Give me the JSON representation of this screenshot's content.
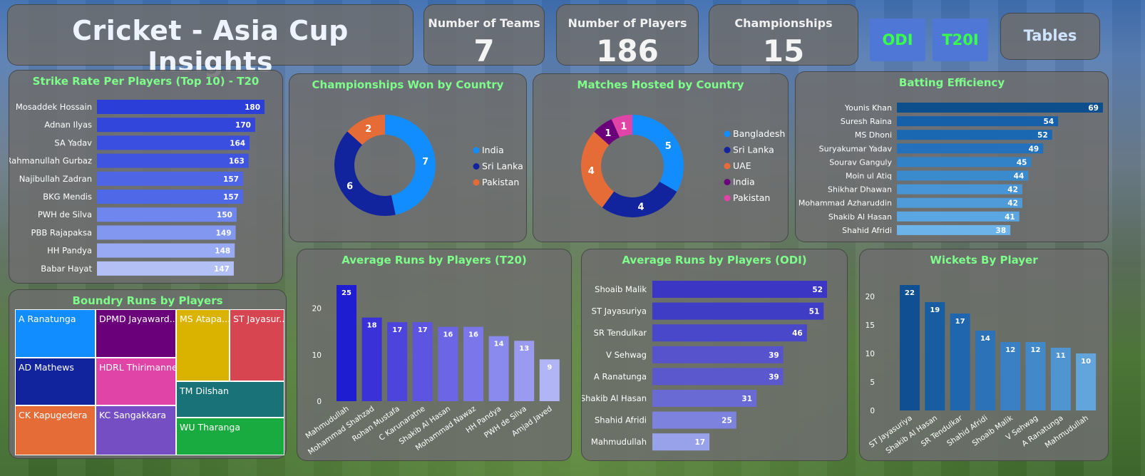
{
  "header": {
    "title": "Cricket - Asia Cup Insights"
  },
  "kpis": [
    {
      "label": "Number of Teams",
      "value": "7"
    },
    {
      "label": "Number of Players",
      "value": "186"
    },
    {
      "label": "Championships",
      "value": "15"
    }
  ],
  "buttons": {
    "odi": "ODI",
    "t20i": "T20I",
    "tables": "Tables"
  },
  "chart_data": [
    {
      "id": "strike_rate",
      "type": "bar",
      "orientation": "horizontal",
      "title": "Strike Rate Per Players (Top 10) - T20",
      "categories": [
        "Mosaddek Hossain",
        "Adnan Ilyas",
        "SA Yadav",
        "Rahmanullah Gurbaz",
        "Najibullah Zadran",
        "BKG Mendis",
        "PWH de Silva",
        "PBB Rajapaksa",
        "HH Pandya",
        "Babar Hayat"
      ],
      "values": [
        180,
        170,
        164,
        163,
        157,
        157,
        150,
        149,
        148,
        147
      ],
      "colors": [
        "#2b3fd8",
        "#3246dc",
        "#3a4ee0",
        "#3f55e2",
        "#4e65e6",
        "#4f68e8",
        "#6f86ee",
        "#8197f0",
        "#98aaf3",
        "#b3c0f6"
      ]
    },
    {
      "id": "championships_won",
      "type": "pie",
      "title": "Championships Won by Country",
      "categories": [
        "India",
        "Sri Lanka",
        "Pakistan"
      ],
      "values": [
        7,
        6,
        2
      ],
      "colors": [
        "#118dff",
        "#12239e",
        "#e66c37"
      ],
      "legend": "right"
    },
    {
      "id": "matches_hosted",
      "type": "pie",
      "title": "Matches Hosted by Country",
      "categories": [
        "Bangladesh",
        "Sri Lanka",
        "UAE",
        "India",
        "Pakistan"
      ],
      "values": [
        5,
        4,
        4,
        1,
        1
      ],
      "colors": [
        "#118dff",
        "#12239e",
        "#e66c37",
        "#6b007b",
        "#e044a7"
      ],
      "legend": "right"
    },
    {
      "id": "batting_efficiency",
      "type": "bar",
      "orientation": "horizontal",
      "title": "Batting Efficiency",
      "categories": [
        "Younis Khan",
        "Suresh Raina",
        "MS Dhoni",
        "Suryakumar Yadav",
        "Sourav Ganguly",
        "Moin ul Atiq",
        "Shikhar Dhawan",
        "Mohammad Azharuddin",
        "Shakib Al Hasan",
        "Shahid Afridi"
      ],
      "values": [
        69,
        54,
        52,
        49,
        45,
        44,
        42,
        42,
        41,
        38
      ],
      "colors": [
        "#0d4e8c",
        "#1560a8",
        "#1b68b2",
        "#2370bc",
        "#3282c8",
        "#3a8ace",
        "#4795d6",
        "#4f9bda",
        "#5aa6e2",
        "#6cb3ea"
      ]
    },
    {
      "id": "boundary_runs",
      "type": "heatmap",
      "title": "Boundry Runs by Players",
      "categories": [
        "A Ranatunga",
        "DPMD Jayawardena",
        "MS Atapattu",
        "ST Jayasuriya",
        "AD Mathews",
        "HDRL Thirimanne",
        "TM Dilshan",
        "CK Kapugedera",
        "KC Sangakkara",
        "WU Tharanga"
      ],
      "labels_shown": [
        "A Ranatunga",
        "DPMD Jayaward...",
        "MS Atapa...",
        "ST Jayasur...",
        "AD Mathews",
        "HDRL Thirimanne",
        "TM Dilshan",
        "CK Kapugedera",
        "KC Sangakkara",
        "WU Tharanga"
      ],
      "colors": [
        "#118dff",
        "#6b007b",
        "#d9b300",
        "#d64550",
        "#12239e",
        "#e044a7",
        "#197278",
        "#e66c37",
        "#744ec2",
        "#1aab40"
      ]
    },
    {
      "id": "avg_runs_t20",
      "type": "bar",
      "orientation": "vertical",
      "title": "Average Runs by Players (T20)",
      "categories": [
        "Mahmudullah",
        "Mohammad Shahzad",
        "Rohan Mustafa",
        "C Karunaratne",
        "Shakib Al Hasan",
        "Mohammad Nawaz",
        "HH Pandya",
        "PWH de Silva",
        "Amjad Javed"
      ],
      "values": [
        25,
        18,
        17,
        17,
        16,
        16,
        14,
        13,
        9
      ],
      "yticks": [
        0,
        10,
        20
      ],
      "colors": [
        "#1f1dd2",
        "#3a32d8",
        "#4d44de",
        "#5d55e2",
        "#6c65e6",
        "#7b76ea",
        "#8a89ee",
        "#9a9af1",
        "#b2b5f5"
      ]
    },
    {
      "id": "avg_runs_odi",
      "type": "bar",
      "orientation": "horizontal",
      "title": "Average Runs by Players (ODI)",
      "categories": [
        "Shoaib Malik",
        "ST Jayasuriya",
        "SR Tendulkar",
        "V Sehwag",
        "A Ranatunga",
        "Shakib Al Hasan",
        "Shahid Afridi",
        "Mahmudullah"
      ],
      "values": [
        52,
        51,
        46,
        39,
        39,
        31,
        25,
        17
      ],
      "colors": [
        "#3b37c4",
        "#3f3cc6",
        "#4a48ca",
        "#5653cc",
        "#5b58ce",
        "#6a6ad4",
        "#7c82de",
        "#97a2ea"
      ]
    },
    {
      "id": "wickets_by_player",
      "type": "bar",
      "orientation": "vertical",
      "title": "Wickets By Player",
      "categories": [
        "ST Jayasuriya",
        "Shakib Al Hasan",
        "SR Tendulkar",
        "Shahid Afridi",
        "Shoaib Malik",
        "V Sehwag",
        "A Ranatunga",
        "Mahmudullah"
      ],
      "values": [
        22,
        19,
        17,
        14,
        12,
        12,
        11,
        10
      ],
      "yticks": [
        0,
        5,
        10,
        15,
        20
      ],
      "colors": [
        "#0f4f92",
        "#175da2",
        "#1f66ae",
        "#2b72b8",
        "#3a80c4",
        "#4189c9",
        "#4f95d2",
        "#62a4dc"
      ]
    }
  ]
}
